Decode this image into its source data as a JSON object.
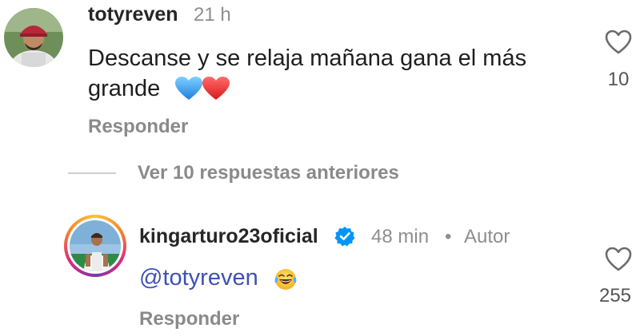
{
  "comments": [
    {
      "username": "totyreven",
      "time": "21 h",
      "text_line1": "Descanse y se relaja mañana gana el más",
      "text_line2": "grande",
      "emojis": [
        "blue-heart",
        "red-heart"
      ],
      "reply_label": "Responder",
      "likes": "10"
    },
    {
      "username": "kingarturo23oficial",
      "verified": true,
      "time": "48 min",
      "separator": "•",
      "author_label": "Autor",
      "mention": "@totyreven",
      "emoji": "tears-of-joy",
      "reply_label": "Responder",
      "likes": "255"
    }
  ],
  "view_replies": "Ver 10 respuestas anteriores",
  "colors": {
    "mention": "#3f51b5",
    "verified": "#0095f6",
    "muted": "#8e8e8e"
  }
}
